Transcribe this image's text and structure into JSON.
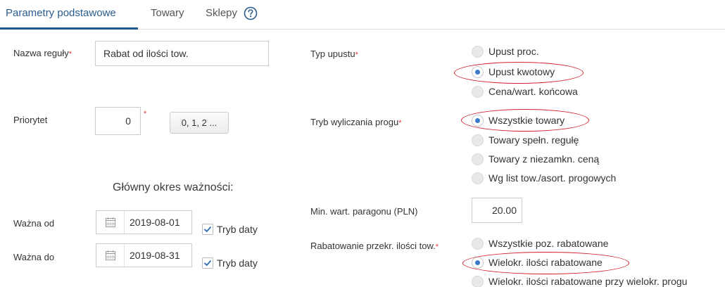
{
  "tabs": [
    {
      "label": "Parametry podstawowe",
      "active": true
    },
    {
      "label": "Towary",
      "active": false
    },
    {
      "label": "Sklepy",
      "active": false
    }
  ],
  "required_mark": "*",
  "rule_name": {
    "label": "Nazwa reguły",
    "value": "Rabat od ilości tow."
  },
  "priority": {
    "label": "Priorytet",
    "value": "0",
    "button_label": "0, 1, 2 ..."
  },
  "validity": {
    "title": "Główny okres ważności:",
    "from": {
      "label": "Ważna od",
      "value": "2019-08-01",
      "mode_label": "Tryb daty",
      "mode_checked": true
    },
    "to": {
      "label": "Ważna do",
      "value": "2019-08-31",
      "mode_label": "Tryb daty",
      "mode_checked": true
    }
  },
  "discount_type": {
    "label": "Typ upustu",
    "options": [
      {
        "label": "Upust proc.",
        "selected": false
      },
      {
        "label": "Upust kwotowy",
        "selected": true
      },
      {
        "label": "Cena/wart. końcowa",
        "selected": false
      }
    ]
  },
  "threshold_mode": {
    "label": "Tryb wyliczania progu",
    "options": [
      {
        "label": "Wszystkie towary",
        "selected": true
      },
      {
        "label": "Towary spełn. regułę",
        "selected": false
      },
      {
        "label": "Towary z niezamkn. ceną",
        "selected": false
      },
      {
        "label": "Wg list tow./asort. progowych",
        "selected": false
      }
    ]
  },
  "min_receipt": {
    "label": "Min. wart. paragonu (PLN)",
    "value": "20.00"
  },
  "exceed_discount": {
    "label": "Rabatowanie przekr. ilości tow.",
    "options": [
      {
        "label": "Wszystkie poz. rabatowane",
        "selected": false
      },
      {
        "label": "Wielokr. ilości rabatowane",
        "selected": true
      },
      {
        "label": "Wielokr. ilości rabatowane przy wielokr. progu",
        "selected": false
      }
    ]
  },
  "colors": {
    "accent": "#1f5a93",
    "required": "#e0393e",
    "annotation": "#d21f2b",
    "radio_dot": "#3b7ac9"
  },
  "icons": {
    "help": "question-circle-icon",
    "calendar": "calendar-icon",
    "check": "check-icon"
  }
}
